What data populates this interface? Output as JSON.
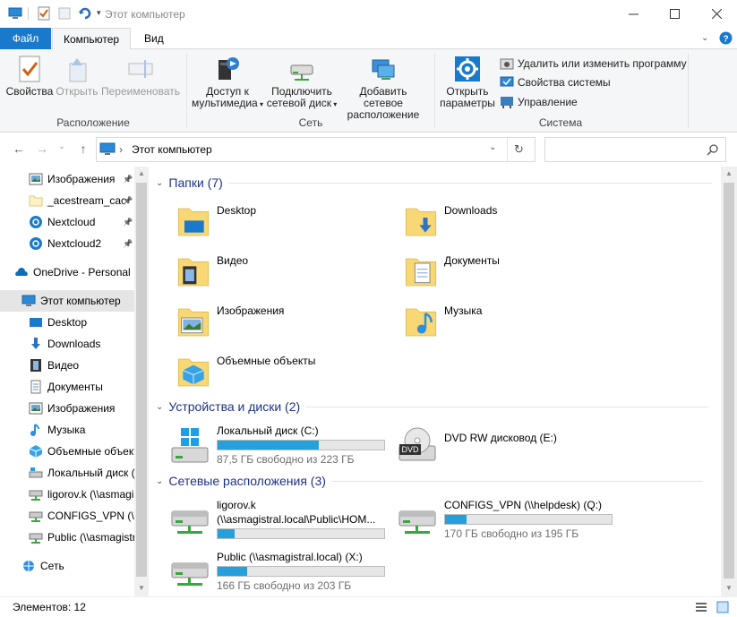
{
  "window": {
    "title": "Этот компьютер",
    "minimize_icon": "minimize-icon",
    "maximize_icon": "maximize-icon",
    "close_icon": "close-icon"
  },
  "ribbon_tabs": {
    "file": "Файл",
    "computer": "Компьютер",
    "view": "Вид"
  },
  "ribbon": {
    "location_group": {
      "label": "Расположение",
      "properties": "Свойства",
      "open": "Открыть",
      "rename": "Переименовать"
    },
    "network_group": {
      "label": "Сеть",
      "media_line1": "Доступ к",
      "media_line2": "мультимедиа",
      "map_line1": "Подключить",
      "map_line2": "сетевой диск",
      "add_line1": "Добавить сетевое",
      "add_line2": "расположение"
    },
    "system_group": {
      "label": "Система",
      "settings_line1": "Открыть",
      "settings_line2": "параметры",
      "uninstall": "Удалить или изменить программу",
      "sysprops": "Свойства системы",
      "manage": "Управление"
    }
  },
  "address": {
    "path": "Этот компьютер",
    "separator": "›"
  },
  "nav_pane": {
    "items": [
      {
        "label": "Изображения",
        "icon": "pictures-icon",
        "pinned": true
      },
      {
        "label": "_acestream_cac",
        "icon": "folder-icon",
        "pinned": true
      },
      {
        "label": "Nextcloud",
        "icon": "nextcloud-icon",
        "pinned": true
      },
      {
        "label": "Nextcloud2",
        "icon": "nextcloud-icon",
        "pinned": true
      },
      {
        "label": "OneDrive - Personal",
        "icon": "onedrive-icon",
        "pinned": false
      },
      {
        "label": "Этот компьютер",
        "icon": "computer-icon",
        "pinned": false
      },
      {
        "label": "Desktop",
        "icon": "desktop-icon",
        "pinned": false
      },
      {
        "label": "Downloads",
        "icon": "downloads-icon",
        "pinned": false
      },
      {
        "label": "Видео",
        "icon": "video-icon",
        "pinned": false
      },
      {
        "label": "Документы",
        "icon": "documents-icon",
        "pinned": false
      },
      {
        "label": "Изображения",
        "icon": "pictures-icon",
        "pinned": false
      },
      {
        "label": "Музыка",
        "icon": "music-icon",
        "pinned": false
      },
      {
        "label": "Объемные объекты",
        "icon": "3d-objects-icon",
        "pinned": false
      },
      {
        "label": "Локальный диск (C:)",
        "icon": "drive-icon",
        "pinned": false
      },
      {
        "label": "ligorov.k (\\\\asmagistral.local)",
        "icon": "network-drive-icon",
        "pinned": false
      },
      {
        "label": "CONFIGS_VPN (\\\\helpdesk)",
        "icon": "network-drive-icon",
        "pinned": false
      },
      {
        "label": "Public (\\\\asmagistral.local)",
        "icon": "network-drive-icon",
        "pinned": false
      },
      {
        "label": "Сеть",
        "icon": "network-icon",
        "pinned": false
      }
    ]
  },
  "content": {
    "folders_header": "Папки (7)",
    "folders": [
      {
        "label": "Desktop",
        "icon": "desktop-folder-icon"
      },
      {
        "label": "Downloads",
        "icon": "downloads-folder-icon"
      },
      {
        "label": "Видео",
        "icon": "video-folder-icon"
      },
      {
        "label": "Документы",
        "icon": "documents-folder-icon"
      },
      {
        "label": "Изображения",
        "icon": "pictures-folder-icon"
      },
      {
        "label": "Музыка",
        "icon": "music-folder-icon"
      },
      {
        "label": "Объемные объекты",
        "icon": "3d-objects-folder-icon"
      }
    ],
    "devices_header": "Устройства и диски (2)",
    "devices": [
      {
        "label": "Локальный диск (C:)",
        "free": "87,5 ГБ свободно из 223 ГБ",
        "used_fraction": 0.61,
        "icon": "windows-drive-icon"
      },
      {
        "label": "DVD RW дисковод (E:)",
        "icon": "dvd-drive-icon",
        "dvd_text": "DVD"
      }
    ],
    "network_header": "Сетевые расположения (3)",
    "network": [
      {
        "label": "ligorov.k",
        "sublabel": "(\\\\asmagistral.local\\Public\\HOM...",
        "used_fraction": 0.1,
        "icon": "network-drive-icon"
      },
      {
        "label": "CONFIGS_VPN (\\\\helpdesk) (Q:)",
        "free": "170 ГБ свободно из 195 ГБ",
        "used_fraction": 0.13,
        "icon": "network-drive-icon"
      },
      {
        "label": "Public (\\\\asmagistral.local) (X:)",
        "free": "166 ГБ свободно из 203 ГБ",
        "used_fraction": 0.18,
        "icon": "network-drive-icon"
      }
    ]
  },
  "status": {
    "items": "Элементов: 12"
  },
  "colors": {
    "accent": "#1979ca",
    "header_text": "#1e3287",
    "bar_fill": "#26a0da",
    "folder": "#f8d775"
  }
}
